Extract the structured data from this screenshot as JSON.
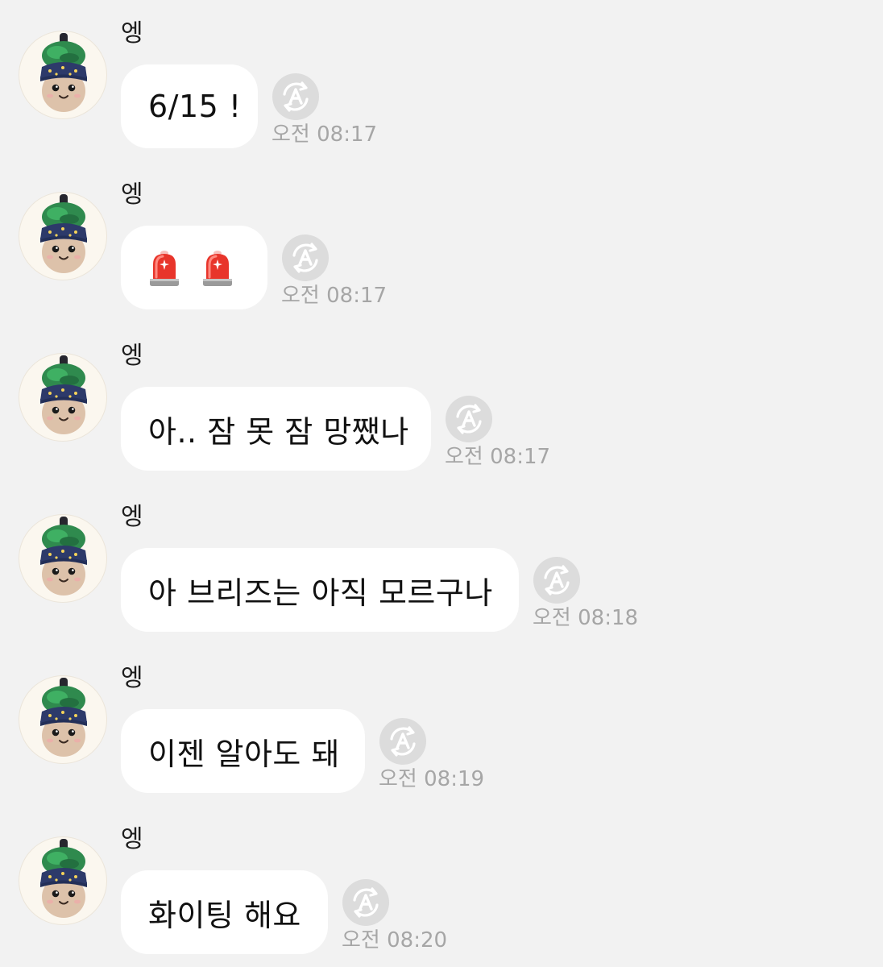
{
  "messages": [
    {
      "sender": "엥",
      "text": "6/15 !",
      "time": "오전 08:17"
    },
    {
      "sender": "엥",
      "emoji": "siren-emoji",
      "emoji_count": 2,
      "time": "오전 08:17"
    },
    {
      "sender": "엥",
      "text": "아.. 잠 못 잠 망쨌나",
      "time": "오전 08:17"
    },
    {
      "sender": "엥",
      "text": "아 브리즈는 아직 모르구나",
      "time": "오전 08:18"
    },
    {
      "sender": "엥",
      "text": "이젠 알아도 돼",
      "time": "오전 08:19"
    },
    {
      "sender": "엥",
      "text": "화이팅 해요",
      "time": "오전 08:20"
    }
  ],
  "icons": {
    "translate": "translate-icon",
    "avatar": "avatar-plush-icon"
  },
  "colors": {
    "background": "#f2f2f2",
    "bubble": "#ffffff",
    "timestamp": "#a6a6a6",
    "siren": "#e8352b"
  }
}
